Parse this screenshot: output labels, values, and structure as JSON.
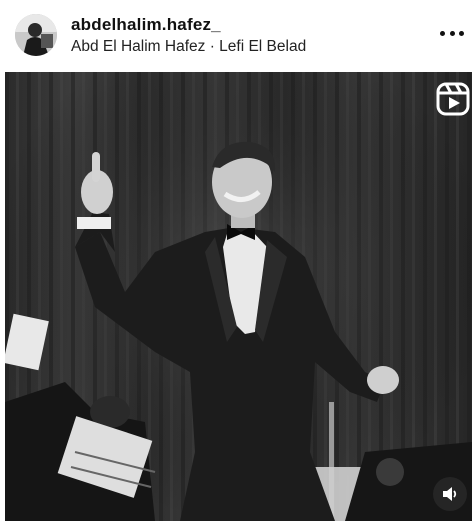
{
  "post": {
    "username": "abdelhalim.hafez_",
    "subtitle": "Abd El Halim Hafez · Lefi El Belad"
  },
  "icons": {
    "more": "more-options-icon",
    "reels": "reels-icon",
    "sound": "speaker-icon"
  },
  "colors": {
    "header_bg": "#ffffff",
    "text_primary": "#111111",
    "media_bg": "#0d0d0d"
  }
}
